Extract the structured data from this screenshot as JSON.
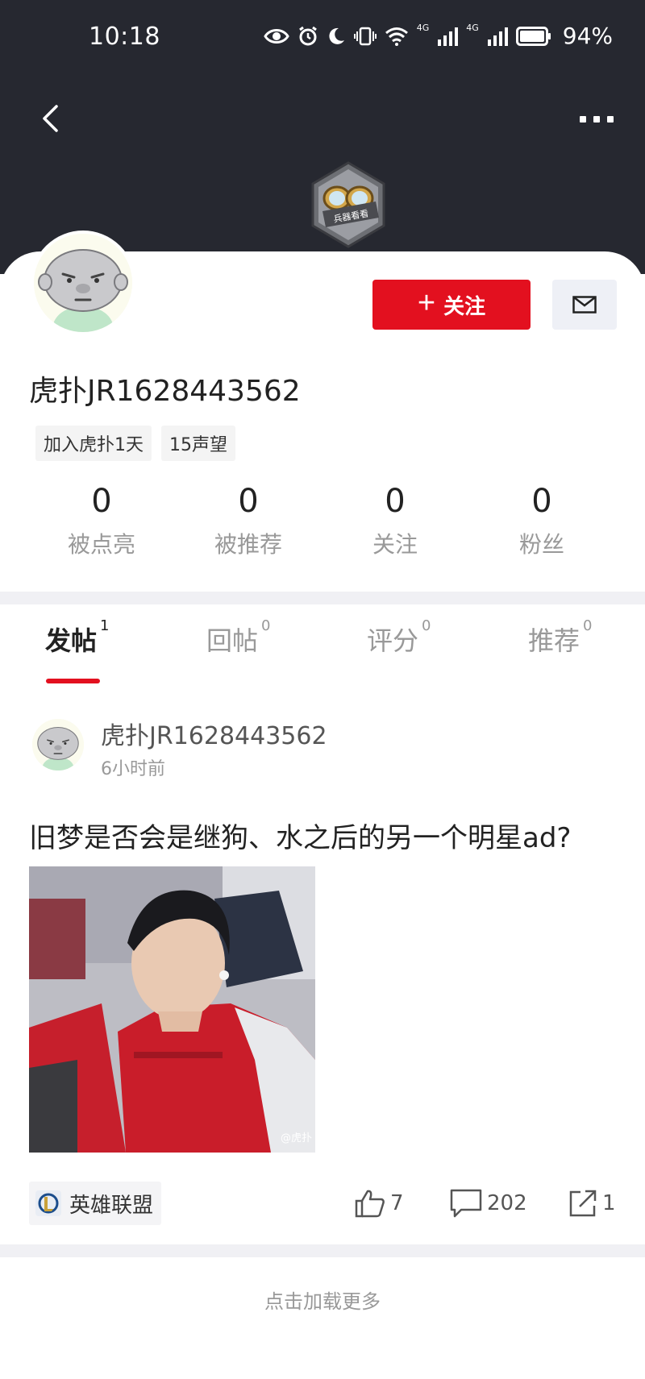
{
  "status_bar": {
    "time": "10:18",
    "network_1": "4G",
    "network_2": "4G",
    "battery": "94%"
  },
  "profile": {
    "username": "虎扑JR1628443562",
    "badge_text": "兵器看看",
    "tags": [
      "加入虎扑1天",
      "15声望"
    ],
    "follow_label": "关注",
    "stats": [
      {
        "value": "0",
        "label": "被点亮"
      },
      {
        "value": "0",
        "label": "被推荐"
      },
      {
        "value": "0",
        "label": "关注"
      },
      {
        "value": "0",
        "label": "粉丝"
      }
    ]
  },
  "tabs": [
    {
      "label": "发帖",
      "count": "1",
      "active": true
    },
    {
      "label": "回帖",
      "count": "0",
      "active": false
    },
    {
      "label": "评分",
      "count": "0",
      "active": false
    },
    {
      "label": "推荐",
      "count": "0",
      "active": false
    }
  ],
  "post": {
    "author": "虎扑JR1628443562",
    "time": "6小时前",
    "title": "旧梦是否会是继狗、水之后的另一个明星ad?",
    "image_watermark": "@虎扑",
    "topic": "英雄联盟",
    "likes": "7",
    "comments": "202",
    "shares": "1"
  },
  "footer": {
    "load_more": "点击加载更多"
  },
  "colors": {
    "header_bg": "#262830",
    "accent_red": "#e3101f",
    "divider": "#f0f0f4"
  },
  "icons": [
    "back-arrow-icon",
    "more-dots-icon",
    "mail-icon",
    "like-icon",
    "comment-icon",
    "share-icon"
  ]
}
